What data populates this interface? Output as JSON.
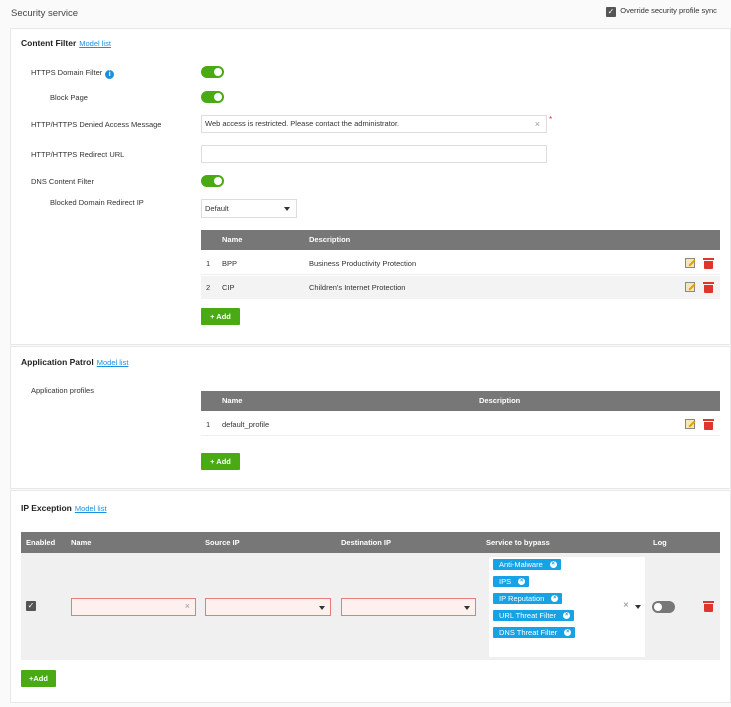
{
  "page": {
    "title": "Security service",
    "override_label": "Override security profile sync"
  },
  "content_filter": {
    "title": "Content Filter",
    "model_link": "Model list",
    "https_domain_filter_label": "HTTPS Domain Filter",
    "https_domain_filter_on": true,
    "block_page_label": "Block Page",
    "block_page_on": true,
    "denied_msg_label": "HTTP/HTTPS Denied Access Message",
    "denied_msg_value": "Web access is restricted. Please contact the administrator.",
    "required_mark": "*",
    "redirect_url_label": "HTTP/HTTPS Redirect URL",
    "redirect_url_value": "",
    "dns_filter_label": "DNS Content Filter",
    "dns_filter_on": true,
    "blocked_redirect_label": "Blocked Domain Redirect IP",
    "blocked_redirect_value": "Default",
    "table_headers": [
      "Name",
      "Description"
    ],
    "rows": [
      {
        "index": "1",
        "name": "BPP",
        "description": "Business Productivity Protection"
      },
      {
        "index": "2",
        "name": "CIP",
        "description": "Children's Internet Protection"
      }
    ],
    "add_label": "+ Add"
  },
  "app_patrol": {
    "title": "Application Patrol",
    "model_link": "Model list",
    "profiles_label": "Application profiles",
    "table_headers": [
      "Name",
      "Description"
    ],
    "rows": [
      {
        "index": "1",
        "name": "default_profile",
        "description": ""
      }
    ],
    "add_label": "+ Add"
  },
  "ip_exception": {
    "title": "IP Exception",
    "model_link": "Model list",
    "table_headers": [
      "Enabled",
      "Name",
      "Source IP",
      "Destination IP",
      "Service to bypass",
      "Log"
    ],
    "row": {
      "enabled": true,
      "services": [
        "Anti-Malware",
        "IPS",
        "IP Reputation",
        "URL Threat Filter",
        "DNS Threat Filter"
      ],
      "log_on": false
    },
    "add_label": "+Add"
  },
  "colors": {
    "accent_green": "#4aaa13",
    "chip_blue": "#17a2e6",
    "delete_red": "#e0342e",
    "link_blue": "#1a8fe0"
  }
}
